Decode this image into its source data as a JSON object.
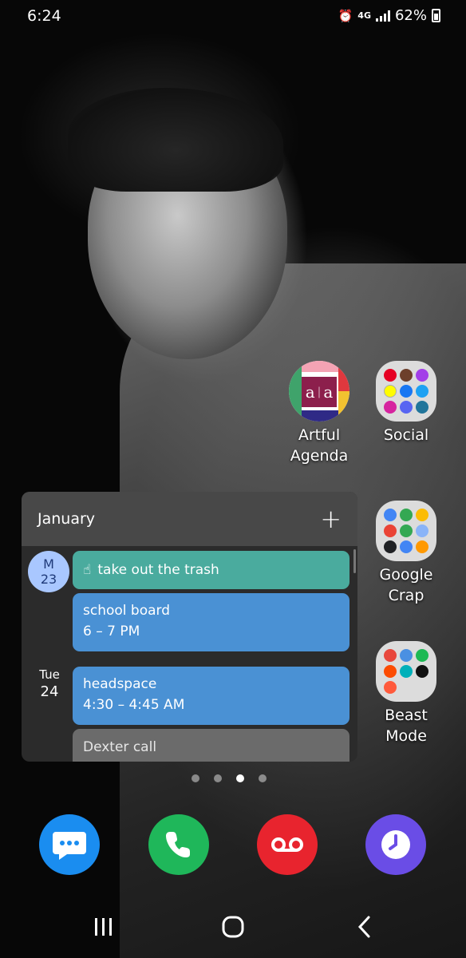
{
  "status_bar": {
    "time": "6:24",
    "network": "4G",
    "battery_percent": "62%",
    "battery_level": 0.62,
    "icons": [
      "alarm-icon",
      "network-4g-icon",
      "signal-icon",
      "battery-icon"
    ]
  },
  "home": {
    "apps": [
      {
        "label_line1": "Artful",
        "label_line2": "Agenda",
        "icon": "artful-agenda-icon"
      },
      {
        "label_line1": "Social",
        "label_line2": "",
        "icon": "folder-icon"
      },
      {
        "label_line1": "Google",
        "label_line2": "Crap",
        "icon": "folder-icon"
      },
      {
        "label_line1": "Beast",
        "label_line2": "Mode",
        "icon": "folder-icon"
      }
    ]
  },
  "calendar_widget": {
    "month": "January",
    "add_icon": "plus-icon",
    "days": [
      {
        "weekday": "M",
        "date": "23"
      },
      {
        "weekday": "Tue",
        "date": "24"
      }
    ],
    "events": [
      {
        "title": "take out the trash",
        "time": "",
        "color": "#4aab9e"
      },
      {
        "title": "school board",
        "time": "6 – 7 PM",
        "color": "#4a91d4"
      },
      {
        "title": "headspace",
        "time": "4:30 – 4:45 AM",
        "color": "#4a91d4"
      },
      {
        "title": "Dexter call",
        "time": "",
        "color": "#6b6b6b"
      }
    ]
  },
  "page_indicator": {
    "pages": 4,
    "active": 3
  },
  "dock": {
    "apps": [
      {
        "icon": "messages-icon",
        "color": "#1a8df0"
      },
      {
        "icon": "phone-icon",
        "color": "#1fb75a"
      },
      {
        "icon": "voicemail-icon",
        "color": "#e8242e"
      },
      {
        "icon": "clock-icon",
        "color": "#6a4de6"
      }
    ]
  },
  "nav_bar": {
    "icons": [
      "recents-icon",
      "home-icon",
      "back-icon"
    ]
  }
}
